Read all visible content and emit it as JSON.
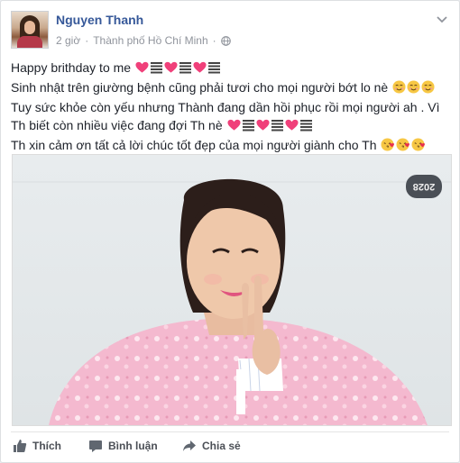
{
  "post": {
    "author": "Nguyen Thanh",
    "time": "2 giờ",
    "location": "Thành phố Hồ Chí Minh",
    "lines": [
      {
        "text": "Happy brithday to me",
        "emojis": [
          "heart",
          "bars",
          "heart",
          "bars",
          "heart",
          "bars"
        ]
      },
      {
        "text": "Sinh nhật trên giường bệnh cũng phải tươi cho mọi người bớt lo nè",
        "emojis": [
          "smile",
          "smile",
          "smile"
        ]
      },
      {
        "text": "Tuy sức khỏe còn yếu nhưng Thành đang dần hồi phục rồi mọi người ah . Vì",
        "emojis": []
      },
      {
        "text": "Th biết còn nhiều việc đang đợi Th nè",
        "emojis": [
          "heart",
          "bars",
          "heart",
          "bars",
          "heart",
          "bars"
        ]
      },
      {
        "text": "Th xin cảm ơn tất cả lời chúc tốt đẹp của mọi người giành cho Th",
        "emojis": [
          "kiss",
          "kiss",
          "kiss"
        ]
      }
    ],
    "photo_sign": "2028"
  },
  "actions": {
    "like": "Thích",
    "comment": "Bình luận",
    "share": "Chia sẻ"
  },
  "colors": {
    "link": "#365899",
    "meta": "#90949c",
    "text": "#1d2129",
    "heart": "#f0407a",
    "gown": "#f2b8cc"
  }
}
